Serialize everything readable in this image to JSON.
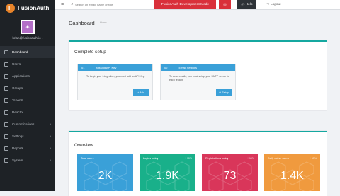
{
  "brand": {
    "name": "FusionAuth",
    "logo_initial": "F"
  },
  "user": {
    "avatar_initial": "✦",
    "email": "brian@fusionauth.io"
  },
  "sidebar": {
    "items": [
      {
        "label": "Dashboard",
        "icon": "dashboard-icon",
        "active": true,
        "chevron": false
      },
      {
        "label": "Users",
        "icon": "users-icon",
        "active": false,
        "chevron": false
      },
      {
        "label": "Applications",
        "icon": "applications-icon",
        "active": false,
        "chevron": false
      },
      {
        "label": "Groups",
        "icon": "groups-icon",
        "active": false,
        "chevron": false
      },
      {
        "label": "Tenants",
        "icon": "tenants-icon",
        "active": false,
        "chevron": false
      },
      {
        "label": "Reactor",
        "icon": "reactor-icon",
        "active": false,
        "chevron": false
      },
      {
        "label": "Customizations",
        "icon": "customizations-icon",
        "active": false,
        "chevron": true
      },
      {
        "label": "Settings",
        "icon": "settings-icon",
        "active": false,
        "chevron": true
      },
      {
        "label": "Reports",
        "icon": "reports-icon",
        "active": false,
        "chevron": true
      },
      {
        "label": "System",
        "icon": "system-icon",
        "active": false,
        "chevron": true
      }
    ]
  },
  "topbar": {
    "search_placeholder": "Search on email, name or role",
    "dev_mode": "FusionAuth Development Mode",
    "help": "Help",
    "logout": "Logout"
  },
  "page": {
    "title": "Dashboard",
    "subtitle": "Home"
  },
  "setup": {
    "title": "Complete setup",
    "cards": [
      {
        "num": "01",
        "title": "Missing API Key",
        "body": "To begin your integration, you must add an API Key.",
        "button": "Add"
      },
      {
        "num": "02",
        "title": "Email Settings",
        "body": "To send emails, you must setup your SMTP server for each tenant.",
        "button": "Setup"
      }
    ]
  },
  "overview": {
    "title": "Overview",
    "stats": [
      {
        "label": "Total users",
        "delta": "",
        "value": "2K",
        "color": "#3aa0d8"
      },
      {
        "label": "Logins today",
        "delta": "+ 10%",
        "value": "1.9K",
        "color": "#19b08a"
      },
      {
        "label": "Registrations today",
        "delta": "+ 19%",
        "value": "73",
        "color": "#d9365a"
      },
      {
        "label": "Daily active users",
        "delta": "+ 13%",
        "value": "1.4K",
        "color": "#f09a3e"
      }
    ]
  }
}
